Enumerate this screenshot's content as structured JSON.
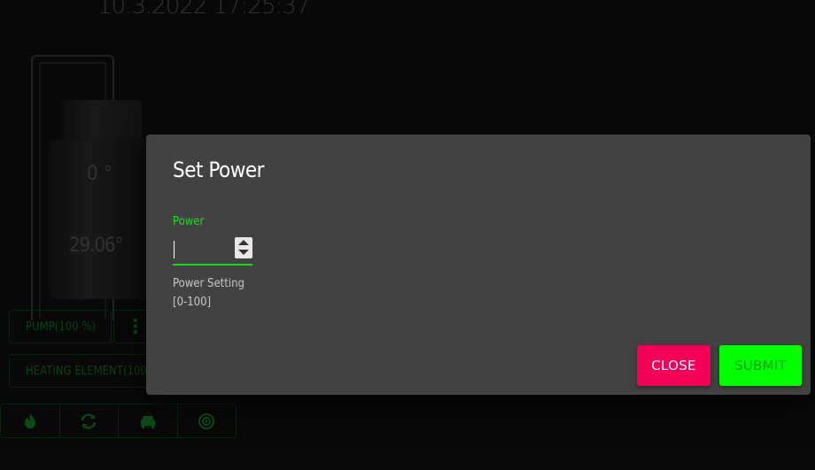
{
  "header": {
    "datetime": "10.3.2022 17:25:37"
  },
  "kettle": {
    "target_temp": "0 °",
    "current_temp": "29.06°"
  },
  "controls": {
    "pump_label": "PUMP(100 %)",
    "pump_menu_icon": "more-vert-icon",
    "heating_label": "HEATING ELEMENT(100"
  },
  "icon_bar": [
    {
      "name": "flame-icon",
      "glyph": "🔥"
    },
    {
      "name": "refresh-icon",
      "glyph": "⟲"
    },
    {
      "name": "car-icon",
      "glyph": "▬"
    },
    {
      "name": "target-icon",
      "glyph": "◎"
    }
  ],
  "dialog": {
    "title": "Set Power",
    "field_label": "Power",
    "field_value": "",
    "helper_line1": "Power Setting",
    "helper_line2": "[0-100]",
    "close_label": "CLOSE",
    "submit_label": "SUBMIT"
  },
  "colors": {
    "accent_green": "#00ff00",
    "close_pink": "#f50057",
    "dialog_bg": "#424242"
  }
}
